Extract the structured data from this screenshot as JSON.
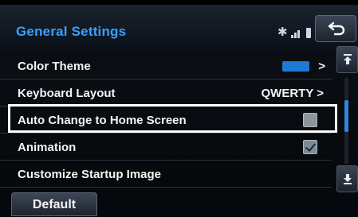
{
  "header": {
    "title": "General Settings"
  },
  "status_icons": [
    "bluetooth-icon",
    "signal-icon",
    "battery-icon"
  ],
  "list": {
    "rows": [
      {
        "label": "Color Theme",
        "value": "",
        "swatch_color": "#1f78d1"
      },
      {
        "label": "Keyboard Layout",
        "value": "QWERTY >"
      },
      {
        "label": "Auto Change to Home Screen",
        "checked": false
      },
      {
        "label": "Animation",
        "checked": true
      },
      {
        "label": "Customize Startup Image"
      }
    ],
    "chevron": ">",
    "highlighted_row": "Auto Change to Home Screen"
  },
  "scroll": {
    "position_fraction": 0.3
  },
  "footer": {
    "default_label": "Default"
  },
  "colors": {
    "title": "#3aa0ff",
    "accent": "#2f86e0",
    "highlight_border": "#ffffff"
  }
}
